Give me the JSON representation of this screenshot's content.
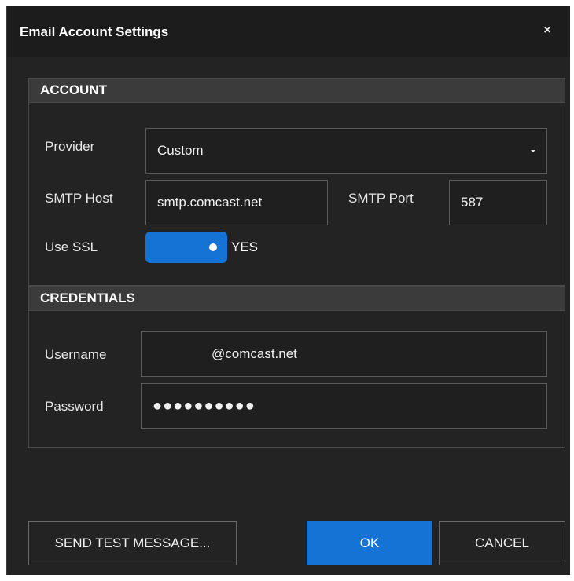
{
  "dialog": {
    "title": "Email Account Settings",
    "close_glyph": "×"
  },
  "account": {
    "header": "ACCOUNT",
    "provider_label": "Provider",
    "provider_value": "Custom",
    "smtp_host_label": "SMTP Host",
    "smtp_host_value": "smtp.comcast.net",
    "smtp_port_label": "SMTP Port",
    "smtp_port_value": "587",
    "use_ssl_label": "Use SSL",
    "use_ssl_value": "YES",
    "use_ssl_on": true
  },
  "credentials": {
    "header": "CREDENTIALS",
    "username_label": "Username",
    "username_value": "@comcast.net",
    "password_label": "Password",
    "password_value": "●●●●●●●●●●"
  },
  "buttons": {
    "send_test": "SEND TEST MESSAGE...",
    "ok": "OK",
    "cancel": "CANCEL"
  },
  "colors": {
    "accent": "#1473d4",
    "background": "#232323",
    "titlebar": "#1c1c1c",
    "group_header": "#3b3b3b"
  },
  "icons": {
    "close": "close-icon",
    "dropdown": "chevron-down-icon"
  }
}
